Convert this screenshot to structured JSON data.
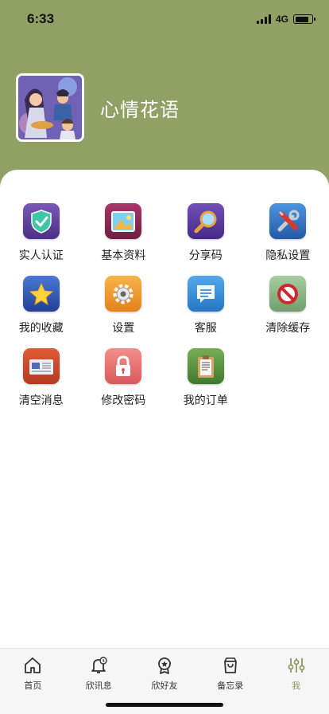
{
  "status_bar": {
    "time": "6:33",
    "network": "4G",
    "battery_level": 0.8
  },
  "profile": {
    "name": "心情花语",
    "avatar_icon": "avatar-illustration"
  },
  "colors": {
    "header": "#91a065",
    "tab_active": "#8b9a60",
    "tab_inactive": "#333333"
  },
  "menu": {
    "items": [
      {
        "label": "实人认证",
        "icon": "shield-check-icon",
        "color": "#5b3f96"
      },
      {
        "label": "基本资料",
        "icon": "picture-icon",
        "color": "#8e2a52"
      },
      {
        "label": "分享码",
        "icon": "magnifier-icon",
        "color": "#5a3b98"
      },
      {
        "label": "隐私设置",
        "icon": "tools-icon",
        "color": "#2f74c4"
      },
      {
        "label": "我的收藏",
        "icon": "star-icon",
        "color": "#2f55b2"
      },
      {
        "label": "设置",
        "icon": "gear-icon",
        "color": "#ef9a2c"
      },
      {
        "label": "客服",
        "icon": "chat-icon",
        "color": "#3a8fd7"
      },
      {
        "label": "清除缓存",
        "icon": "no-entry-icon",
        "color": "#8fb98d"
      },
      {
        "label": "清空消息",
        "icon": "news-icon",
        "color": "#d0472c"
      },
      {
        "label": "修改密码",
        "icon": "lock-icon",
        "color": "#e96f6b"
      },
      {
        "label": "我的订单",
        "icon": "clipboard-icon",
        "color": "#5a8f3e"
      }
    ]
  },
  "tabbar": {
    "items": [
      {
        "label": "首页",
        "icon": "home-icon",
        "active": false
      },
      {
        "label": "欣讯息",
        "icon": "bell-icon",
        "active": false
      },
      {
        "label": "欣好友",
        "icon": "badge-star-icon",
        "active": false
      },
      {
        "label": "备忘录",
        "icon": "bag-icon",
        "active": false
      },
      {
        "label": "我",
        "icon": "sliders-icon",
        "active": true
      }
    ]
  }
}
